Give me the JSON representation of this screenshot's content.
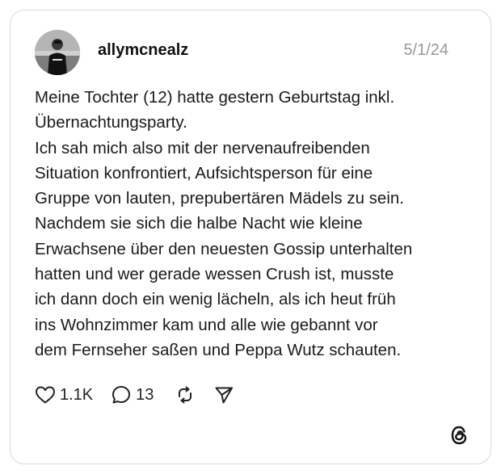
{
  "post": {
    "username": "allymcnealz",
    "date": "5/1/24",
    "text": "Meine Tochter (12) hatte gestern Geburtstag inkl.\nÜbernachtungsparty.\nIch sah mich also mit der nervenaufreibenden\nSituation konfrontiert, Aufsichtsperson für eine\nGruppe von lauten, prepubertären Mädels zu sein.\nNachdem sie sich die halbe Nacht wie kleine\nErwachsene über den neuesten Gossip unterhalten\nhatten und wer gerade wessen Crush ist, musste\nich dann doch ein wenig lächeln, als ich heut früh\nins Wohnzimmer kam und alle wie gebannt vor\ndem Fernseher saßen und Peppa Wutz schauten."
  },
  "actions": {
    "likes": "1.1K",
    "replies": "13"
  },
  "icons": {
    "like": "heart-icon",
    "reply": "comment-icon",
    "repost": "repost-icon",
    "share": "send-icon",
    "brand": "threads-logo-icon"
  }
}
